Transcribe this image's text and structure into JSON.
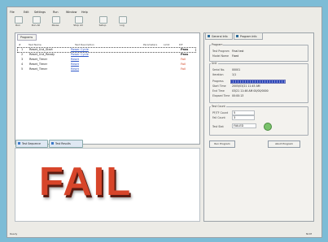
{
  "window": {
    "menus": [
      "File",
      "Edit",
      "Settings",
      "Run",
      "Window",
      "Help"
    ],
    "toolbar": [
      "Run",
      "Run All",
      "Pause",
      "Stop All",
      "Setup",
      "Log"
    ]
  },
  "left_pane": {
    "tab": "Programs",
    "columns": [
      "#",
      "Test Name",
      "Test Description",
      "Parameters",
      "Limit",
      "P/F"
    ],
    "rows": [
      {
        "idx": "1",
        "name": "Reset_Uut_Start",
        "link": "Power Cycle",
        "status": "Pass"
      },
      {
        "idx": "2",
        "name": "Reset_Uut_Ready",
        "link": "Power Cycle",
        "status": "Pass"
      },
      {
        "idx": "3",
        "name": "Reset_Timer",
        "link": "Reset",
        "status": "Fail"
      },
      {
        "idx": "4",
        "name": "Reset_Timer",
        "link": "Reset",
        "status": "Fail"
      },
      {
        "idx": "5",
        "name": "Reset_Timer",
        "link": "Reset",
        "status": "Fail"
      }
    ]
  },
  "bottom_tabs": [
    "Test Sequence",
    "Test Results"
  ],
  "result_banner": "FAIL",
  "right_pane": {
    "tabs": [
      "General Info",
      "Program Info"
    ],
    "program_group": {
      "title": "Program",
      "fields": [
        {
          "label": "Test Program",
          "value": "Final test"
        },
        {
          "label": "Model Name",
          "value": "Fixed"
        }
      ]
    },
    "unit_group": {
      "title": "Unit",
      "fields": [
        {
          "label": "Serial No.",
          "value": "00001"
        },
        {
          "label": "Iteration",
          "value": "1/1"
        },
        {
          "label": "Progress",
          "value": ""
        },
        {
          "label": "Start Time",
          "value": "2005/03/21 11:45 AM"
        },
        {
          "label": "End Time",
          "value": "03/21 11:46 AM 00/00/0000"
        },
        {
          "label": "Elapsed Time",
          "value": "00:00:13"
        }
      ]
    },
    "test_group": {
      "title": "Test Count",
      "fields": [
        {
          "label": "PF/TF Count",
          "value": "5"
        },
        {
          "label": "Fail Count",
          "value": "3"
        }
      ]
    },
    "result": {
      "label": "Test Stat",
      "value": "FAILED"
    },
    "buttons": [
      "Run Program",
      "Abort Program"
    ]
  },
  "status_bar": {
    "left": "Ready",
    "right": "NUM"
  }
}
